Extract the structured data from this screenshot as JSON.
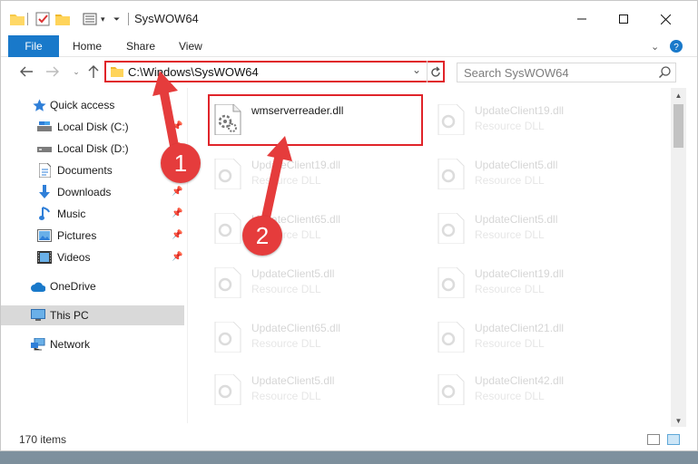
{
  "window": {
    "title": "SysWOW64"
  },
  "ribbon": {
    "tabs": [
      "File",
      "Home",
      "Share",
      "View"
    ]
  },
  "nav": {
    "address": "C:\\Windows\\SysWOW64",
    "search_placeholder": "Search SysWOW64"
  },
  "sidebar": {
    "items": [
      {
        "label": "Quick access",
        "icon": "star-icon",
        "pinned": false
      },
      {
        "label": "Local Disk (C:)",
        "icon": "drive-icon",
        "pinned": true
      },
      {
        "label": "Local Disk (D:)",
        "icon": "drive-icon",
        "pinned": true
      },
      {
        "label": "Documents",
        "icon": "documents-icon",
        "pinned": true
      },
      {
        "label": "Downloads",
        "icon": "downloads-icon",
        "pinned": true
      },
      {
        "label": "Music",
        "icon": "music-icon",
        "pinned": true
      },
      {
        "label": "Pictures",
        "icon": "pictures-icon",
        "pinned": true
      },
      {
        "label": "Videos",
        "icon": "videos-icon",
        "pinned": true
      },
      {
        "label": "OneDrive",
        "icon": "cloud-icon",
        "pinned": false
      },
      {
        "label": "This PC",
        "icon": "computer-icon",
        "pinned": false,
        "selected": true
      },
      {
        "label": "Network",
        "icon": "network-icon",
        "pinned": false
      }
    ]
  },
  "files": [
    {
      "name": "wmserverreader.dll",
      "type": "",
      "highlighted": true
    },
    {
      "name": "UpdateClient19.dll",
      "type": "Resource DLL"
    },
    {
      "name": "UpdateClient19.dll",
      "type": "Resource DLL"
    },
    {
      "name": "UpdateClient5.dll",
      "type": "Resource DLL"
    },
    {
      "name": "UpdateClient65.dll",
      "type": "Resource DLL"
    },
    {
      "name": "UpdateClient5.dll",
      "type": "Resource DLL"
    },
    {
      "name": "UpdateClient5.dll",
      "type": "Resource DLL"
    },
    {
      "name": "UpdateClient19.dll",
      "type": "Resource DLL"
    },
    {
      "name": "UpdateClient65.dll",
      "type": "Resource DLL"
    },
    {
      "name": "UpdateClient21.dll",
      "type": "Resource DLL"
    },
    {
      "name": "UpdateClient5.dll",
      "type": "Resource DLL"
    },
    {
      "name": "UpdateClient42.dll",
      "type": "Resource DLL"
    }
  ],
  "status": {
    "item_count": "170 items"
  },
  "annotations": [
    {
      "number": "1"
    },
    {
      "number": "2"
    }
  ],
  "colors": {
    "accent": "#1979ca",
    "highlight": "#e0242a",
    "badge": "#e53c3c"
  }
}
